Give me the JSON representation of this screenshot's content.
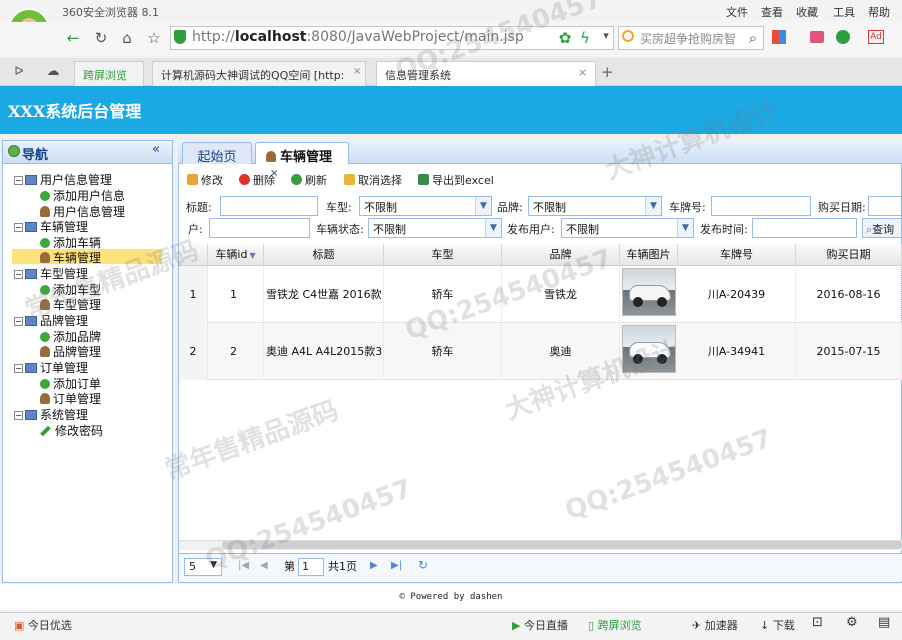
{
  "browser": {
    "title": "360安全浏览器 8.1",
    "menu": [
      "文件",
      "查看",
      "收藏",
      "工具",
      "帮助"
    ],
    "url_prefix": "http://",
    "url_host": "localhost",
    "url_rest": ":8080/JavaWebProject/main.jsp",
    "search_placeholder": "买房超争抢购房智",
    "tabs": [
      {
        "label": "跨屏浏览"
      },
      {
        "label": "计算机源码大神调试的QQ空间 [http:"
      },
      {
        "label": "信息管理系统"
      }
    ]
  },
  "app": {
    "title": "XXX系统后台管理"
  },
  "sidebar": {
    "title": "导航",
    "collapse": "«",
    "groups": [
      {
        "label": "用户信息管理",
        "items": [
          "添加用户信息",
          "用户信息管理"
        ]
      },
      {
        "label": "车辆管理",
        "items": [
          "添加车辆",
          "车辆管理"
        ]
      },
      {
        "label": "车型管理",
        "items": [
          "添加车型",
          "车型管理"
        ]
      },
      {
        "label": "品牌管理",
        "items": [
          "添加品牌",
          "品牌管理"
        ]
      },
      {
        "label": "订单管理",
        "items": [
          "添加订单",
          "订单管理"
        ]
      },
      {
        "label": "系统管理",
        "items": [
          "修改密码"
        ]
      }
    ]
  },
  "main": {
    "tabs": [
      "起始页",
      "车辆管理"
    ],
    "toolbar": [
      "修改",
      "删除",
      "刷新",
      "取消选择",
      "导出到excel"
    ],
    "filters": {
      "title": "标题:",
      "cartype": "车型:",
      "cartype_value": "不限制",
      "brand": "品牌:",
      "brand_value": "不限制",
      "plate": "车牌号:",
      "buydate": "购买日期:",
      "user": "户:",
      "status": "车辆状态:",
      "status_value": "不限制",
      "publisher": "发布用户:",
      "publisher_value": "不限制",
      "pubtime": "发布时间:",
      "query": "查询"
    },
    "columns": [
      "车辆id",
      "标题",
      "车型",
      "品牌",
      "车辆图片",
      "车牌号",
      "购买日期"
    ],
    "rows": [
      {
        "n": "1",
        "id": "1",
        "title": "雪铁龙 C4世嘉 2016款",
        "type": "轿车",
        "brand": "雪铁龙",
        "plate": "川A-20439",
        "date": "2016-08-16"
      },
      {
        "n": "2",
        "id": "2",
        "title": "奥迪 A4L A4L2015款3",
        "type": "轿车",
        "brand": "奥迪",
        "plate": "川A-34941",
        "date": "2015-07-15"
      }
    ],
    "pager": {
      "size": "5",
      "page_label": "第",
      "page": "1",
      "total": "共1页"
    }
  },
  "footer": "© Powered by dashen",
  "statusbar": [
    "今日优选",
    "今日直播",
    "跨屏浏览",
    "加速器",
    "下载"
  ],
  "watermarks": [
    "QQ:254540457",
    "大神计算机设计",
    "常年售精品源码"
  ]
}
